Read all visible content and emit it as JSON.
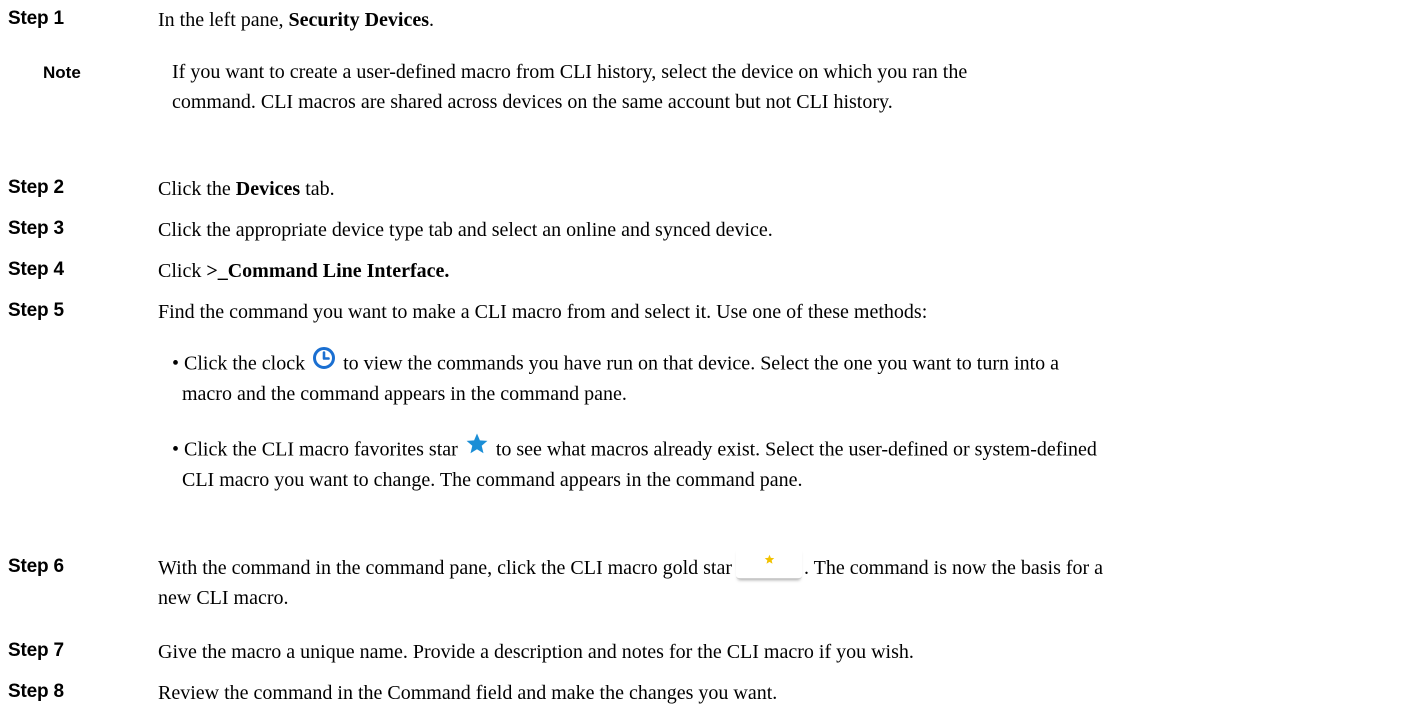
{
  "steps": [
    {
      "label": "Step 1",
      "pre": "In the left pane, ",
      "bold": "Security Devices",
      "post": "."
    },
    {
      "label": "Step 2",
      "pre": "Click the ",
      "bold": "Devices",
      "post": " tab."
    },
    {
      "label": "Step 3",
      "text": "Click the appropriate device type tab and select an online and synced device."
    },
    {
      "label": "Step 4",
      "pre": "Click ",
      "bold": ">_Command Line Interface."
    },
    {
      "label": "Step 5",
      "text": "Find the command you want to make a CLI macro from and select it. Use one of these methods:"
    },
    {
      "label": "Step 6",
      "pre": "With the command in the command pane, click the CLI macro gold star",
      "post": ". The command is now the basis for a",
      "line2": "new CLI macro."
    },
    {
      "label": "Step 7",
      "text": "Give the macro a unique name. Provide a description and notes for the CLI macro if you wish."
    },
    {
      "label": "Step 8",
      "text": "Review the command in the Command field and make the changes you want."
    }
  ],
  "note": {
    "label": "Note",
    "line1": "If you want to create a user-defined macro from CLI history, select the device on which you ran the",
    "line2": "command. CLI macros are shared across devices on the same account but not CLI history."
  },
  "bullets": [
    {
      "pre": "• Click the clock",
      "icon": "clock-icon",
      "post": "to view the commands you have run on that device. Select the one you want to turn into a",
      "line2": "macro and the command appears in the command pane."
    },
    {
      "pre": "• Click the CLI macro favorites star",
      "icon": "star-icon",
      "post": "to see what macros already exist. Select the user-defined or system-defined",
      "line2": "CLI macro you want to change. The command appears in the command pane."
    }
  ],
  "colors": {
    "clock_icon": "#1a6fd1",
    "favorites_star": "#1b8ed6",
    "gold_star": "#f2c200"
  }
}
